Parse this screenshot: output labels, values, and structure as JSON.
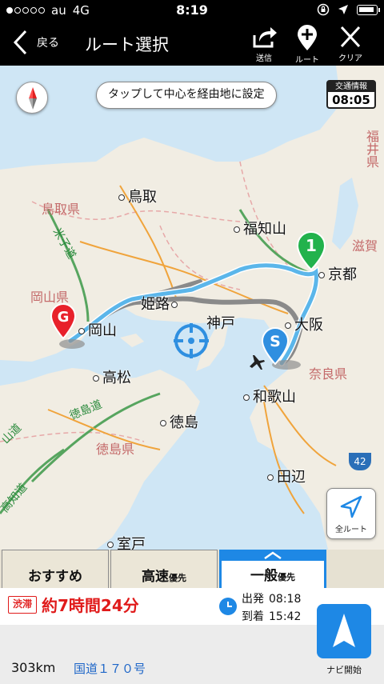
{
  "status_bar": {
    "carrier": "au",
    "network": "4G",
    "time": "8:19"
  },
  "nav": {
    "back_label": "戻る",
    "title": "ルート選択",
    "actions": [
      {
        "label": "送信",
        "icon": "share-icon"
      },
      {
        "label": "ルート",
        "icon": "add-waypoint-icon"
      },
      {
        "label": "クリア",
        "icon": "close-icon"
      }
    ]
  },
  "map": {
    "hint": "タップして中心を経由地に設定",
    "traffic_label": "交通情報",
    "traffic_time": "08:05",
    "all_route_label": "全ルート",
    "pins": {
      "start": "S",
      "goal": "G",
      "waypoint": "1"
    },
    "cities": [
      "鳥取",
      "福知山",
      "京都",
      "姫路",
      "神戸",
      "大阪",
      "岡山",
      "高松",
      "徳島",
      "和歌山",
      "田辺",
      "室戸"
    ],
    "prefectures": [
      "鳥取県",
      "岡山県",
      "徳島県",
      "奈良県",
      "滋賀",
      "福井県"
    ],
    "roads": [
      "米子道",
      "徳島道",
      "山道",
      "高知道"
    ],
    "road_number": "42",
    "colors": {
      "route": "#5bb6ea",
      "land": "#f1ede3",
      "sea": "#cfe6f5",
      "start_pin": "#2f8fe0",
      "goal_pin": "#e8212b",
      "waypoint_pin": "#22b24c"
    }
  },
  "tabs": [
    {
      "label": "おすすめ",
      "suffix": ""
    },
    {
      "label": "高速",
      "suffix": "優先"
    },
    {
      "label": "一般",
      "suffix": "優先"
    }
  ],
  "summary": {
    "jam_badge": "渋滞",
    "duration": "約7時間24分",
    "departure_label": "出発",
    "departure_time": "08:18",
    "arrival_label": "到着",
    "arrival_time": "15:42",
    "distance": "303km",
    "road": "国道１７０号",
    "navi_label": "ナビ開始"
  }
}
